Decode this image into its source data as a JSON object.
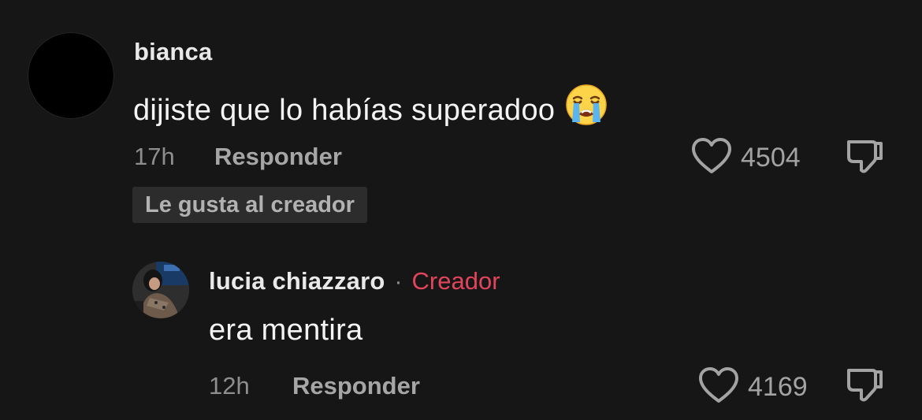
{
  "comments": [
    {
      "username": "bianca",
      "text": "dijiste que lo habías superadoo",
      "emoji": "loudly-crying-face",
      "time": "17h",
      "reply_label": "Responder",
      "likes": "4504",
      "badge": "Le gusta al creador"
    },
    {
      "username": "lucia chiazzaro",
      "separator": "·",
      "creator_label": "Creador",
      "text": "era mentira",
      "time": "12h",
      "reply_label": "Responder",
      "likes": "4169"
    }
  ],
  "colors": {
    "background": "#161616",
    "creator_accent": "#e2445c",
    "badge_bg": "#2c2c2c",
    "muted_text": "#8e8e8e"
  }
}
